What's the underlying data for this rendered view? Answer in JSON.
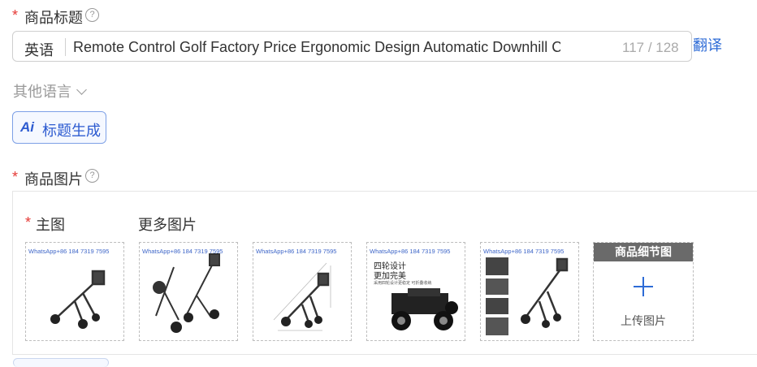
{
  "title_section": {
    "required_mark": "*",
    "label": "商品标题",
    "help_icon": "?",
    "language": "英语",
    "title_value": "Remote Control Golf   Factory Price Ergonomic Design Automatic Downhill Control Con",
    "char_count": "117 / 128",
    "translate_link": "翻译",
    "other_languages": "其他语言",
    "ai_button": {
      "icon_text": "Ai",
      "label": "标题生成"
    }
  },
  "image_section": {
    "required_mark": "*",
    "label": "商品图片",
    "help_icon": "?",
    "main_image_label": "主图",
    "more_images_label": "更多图片",
    "watermark": "WhatsApp+86 184 7319 7595",
    "thumb4_caption_1": "四轮设计",
    "thumb4_caption_2": "更加完美",
    "thumb4_caption_small": "采用四轮设计更稳定 可折叠收纳",
    "upload_card": {
      "header": "商品细节图",
      "label": "上传图片"
    }
  },
  "colors": {
    "accent": "#2d6bd6",
    "required": "#e53935",
    "ai_border": "#7da0e6"
  },
  "icons": [
    "help-circle-icon",
    "chevron-down-icon",
    "ai-icon",
    "plus-icon",
    "golf-cart-image"
  ]
}
